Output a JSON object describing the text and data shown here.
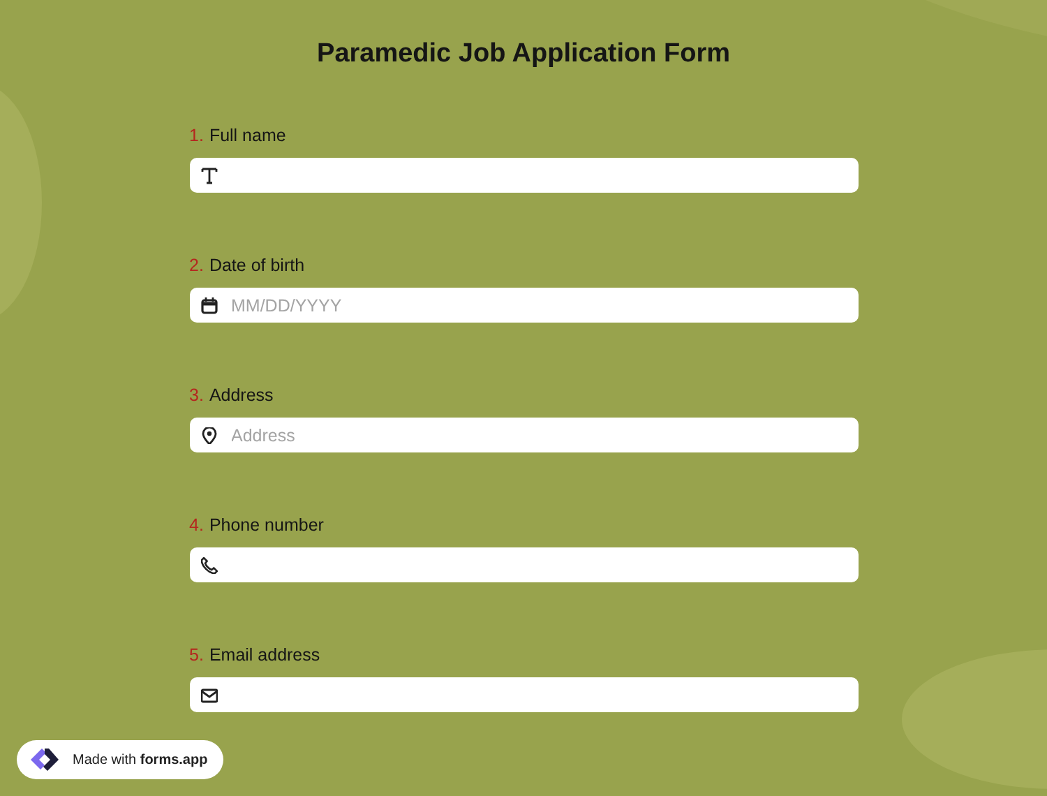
{
  "title": "Paramedic Job Application Form",
  "questions": [
    {
      "number": "1.",
      "label": "Full name",
      "kind": "text"
    },
    {
      "number": "2.",
      "label": "Date of birth",
      "kind": "date",
      "placeholder": "MM/DD/YYYY"
    },
    {
      "number": "3.",
      "label": "Address",
      "kind": "address",
      "placeholder": "Address"
    },
    {
      "number": "4.",
      "label": "Phone number",
      "kind": "phone"
    },
    {
      "number": "5.",
      "label": "Email address",
      "kind": "email"
    }
  ],
  "badge": "Made with **forms.app**"
}
